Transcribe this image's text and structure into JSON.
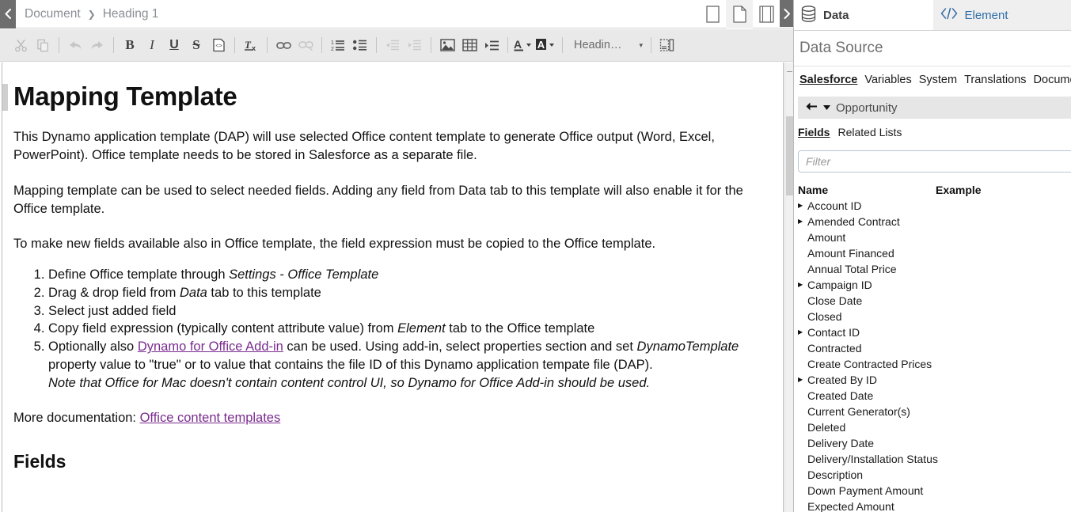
{
  "breadcrumb": {
    "back_icon": "chevron-left-icon",
    "items": [
      "Document",
      "Heading 1"
    ],
    "separator": "❯"
  },
  "view_modes": [
    {
      "name": "page-view-icon",
      "active": false
    },
    {
      "name": "document-view-icon",
      "active": true
    },
    {
      "name": "layout-view-icon",
      "active": false
    }
  ],
  "panel_toggle": {
    "icon": "chevron-right-icon"
  },
  "toolbar": {
    "groups": [
      [
        {
          "name": "cut-icon",
          "label": "Cut",
          "disabled": true
        },
        {
          "name": "copy-icon",
          "label": "Copy",
          "disabled": true
        }
      ],
      [
        {
          "name": "undo-icon",
          "label": "Undo",
          "disabled": true
        },
        {
          "name": "redo-icon",
          "label": "Redo",
          "disabled": true
        }
      ],
      [
        {
          "name": "bold-icon",
          "label": "Bold",
          "disabled": false
        },
        {
          "name": "italic-icon",
          "label": "Italic",
          "disabled": false
        },
        {
          "name": "underline-icon",
          "label": "Underline",
          "disabled": false
        },
        {
          "name": "strikethrough-icon",
          "label": "Strikethrough",
          "disabled": false
        },
        {
          "name": "source-code-icon",
          "label": "Source",
          "disabled": false
        }
      ],
      [
        {
          "name": "remove-format-icon",
          "label": "Remove Format",
          "disabled": false
        }
      ],
      [
        {
          "name": "link-icon",
          "label": "Link",
          "disabled": false
        },
        {
          "name": "unlink-icon",
          "label": "Unlink",
          "disabled": true
        }
      ],
      [
        {
          "name": "numbered-list-icon",
          "label": "Numbered List",
          "disabled": false
        },
        {
          "name": "bulleted-list-icon",
          "label": "Bulleted List",
          "disabled": false
        }
      ],
      [
        {
          "name": "outdent-icon",
          "label": "Decrease Indent",
          "disabled": true
        },
        {
          "name": "indent-icon",
          "label": "Increase Indent",
          "disabled": true
        }
      ],
      [
        {
          "name": "image-icon",
          "label": "Image",
          "disabled": false
        },
        {
          "name": "table-icon",
          "label": "Table",
          "disabled": false
        },
        {
          "name": "insert-field-icon",
          "label": "Insert Field",
          "disabled": false
        }
      ],
      [
        {
          "name": "text-color-icon",
          "label": "Text Color",
          "disabled": false
        },
        {
          "name": "background-color-icon",
          "label": "Background Color",
          "disabled": false
        }
      ]
    ],
    "style_select": {
      "value": "Headin…",
      "caret": "▾"
    },
    "page_break": {
      "name": "page-break-icon",
      "label": "Page Break"
    }
  },
  "document": {
    "title": "Mapping Template",
    "paragraph1_a": "This Dynamo application template (DAP) will use selected Office content template to generate Office output (Word, Excel, PowerPoint). Office template needs to be stored in Salesforce as a separate file.",
    "paragraph2": "Mapping template can be used to select needed fields. Adding any field from Data tab to this template will also enable it for the Office template.",
    "paragraph3": "To make new fields available also in Office template, the field expression must be copied to the Office template.",
    "steps": {
      "s1_a": "Define Office template through ",
      "s1_i": "Settings - Office Template",
      "s2_a": "Drag & drop field from ",
      "s2_i": "Data",
      "s2_b": " tab to this template",
      "s3_a": "Select just added field",
      "s4_a": "Copy field expression (typically content attribute value) from ",
      "s4_i": "Element",
      "s4_b": " tab to the Office template",
      "s5_a": "Optionally also ",
      "s5_link": "Dynamo for Office Add-in",
      "s5_b": " can be used. Using add-in, select properties section and set ",
      "s5_i": "DynamoTemplate",
      "s5_c": " property value to \"true\" or to value that contains the file ID of this Dynamo application tempate file (DAP).",
      "s5_note": "Note that Office for Mac doesn't contain content control UI, so Dynamo for Office Add-in should be used."
    },
    "more_docs_label": "More documentation: ",
    "more_docs_link": "Office content templates",
    "fields_heading": "Fields"
  },
  "data_panel": {
    "tabs": [
      {
        "label": "Data",
        "icon": "database-icon",
        "active": true
      },
      {
        "label": "Element",
        "icon": "code-brackets-icon",
        "active": false
      }
    ],
    "data_source_title": "Data Source",
    "source_tabs": [
      {
        "label": "Salesforce",
        "active": true
      },
      {
        "label": "Variables",
        "active": false
      },
      {
        "label": "System",
        "active": false
      },
      {
        "label": "Translations",
        "active": false
      },
      {
        "label": "Documents",
        "active": false
      }
    ],
    "object_bar": {
      "back_icon": "arrow-left-icon",
      "caret_icon": "caret-down-icon",
      "object_name": "Opportunity"
    },
    "field_tabs": [
      {
        "label": "Fields",
        "active": true
      },
      {
        "label": "Related Lists",
        "active": false
      }
    ],
    "filter": {
      "value": "",
      "placeholder": "Filter"
    },
    "columns": [
      "Name",
      "Example"
    ],
    "fields": [
      {
        "name": "Account ID",
        "expandable": true,
        "example": ""
      },
      {
        "name": "Amended Contract",
        "expandable": true,
        "example": ""
      },
      {
        "name": "Amount",
        "expandable": false,
        "example": ""
      },
      {
        "name": "Amount Financed",
        "expandable": false,
        "example": ""
      },
      {
        "name": "Annual Total Price",
        "expandable": false,
        "example": ""
      },
      {
        "name": "Campaign ID",
        "expandable": true,
        "example": ""
      },
      {
        "name": "Close Date",
        "expandable": false,
        "example": ""
      },
      {
        "name": "Closed",
        "expandable": false,
        "example": ""
      },
      {
        "name": "Contact ID",
        "expandable": true,
        "example": ""
      },
      {
        "name": "Contracted",
        "expandable": false,
        "example": ""
      },
      {
        "name": "Create Contracted Prices",
        "expandable": false,
        "example": ""
      },
      {
        "name": "Created By ID",
        "expandable": true,
        "example": ""
      },
      {
        "name": "Created Date",
        "expandable": false,
        "example": ""
      },
      {
        "name": "Current Generator(s)",
        "expandable": false,
        "example": ""
      },
      {
        "name": "Deleted",
        "expandable": false,
        "example": ""
      },
      {
        "name": "Delivery Date",
        "expandable": false,
        "example": ""
      },
      {
        "name": "Delivery/Installation Status",
        "expandable": false,
        "example": ""
      },
      {
        "name": "Description",
        "expandable": false,
        "example": ""
      },
      {
        "name": "Down Payment Amount",
        "expandable": false,
        "example": ""
      },
      {
        "name": "Expected Amount",
        "expandable": false,
        "example": ""
      }
    ],
    "expand_glyph": "▶"
  },
  "colors": {
    "link": "#7a2c8f",
    "tab_accent": "#2f6fa8",
    "toolbar_bg": "#e9e9e9",
    "panel_header_bg": "#e6e6e6",
    "dark_chrome": "#6e6e6e"
  }
}
